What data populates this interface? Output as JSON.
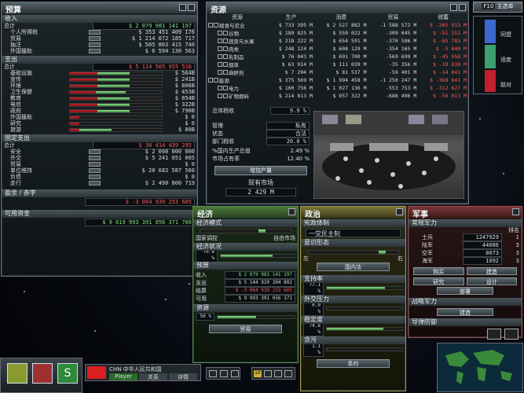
{
  "budget": {
    "title": "预算",
    "income": {
      "header": "收入",
      "total_label": "总计",
      "total": "$ 2 079 981 141 197",
      "items": [
        {
          "label": "个人所得税",
          "value": "$ 353 451 409 176"
        },
        {
          "label": "贸易",
          "value": "$ 1 214 072 185 717"
        },
        {
          "label": "抽注",
          "value": "$ 505 863 415 740"
        },
        {
          "label": "外国援助",
          "value": "$ 6 594 130 563"
        }
      ]
    },
    "expense": {
      "header": "支出",
      "total_label": "总计",
      "total": "$ 5 114 505 955 516",
      "items": [
        {
          "label": "基础设施",
          "value": "$ 564B",
          "fill": 0.3,
          "g": 0.35
        },
        {
          "label": "宣传",
          "value": "$ 241B",
          "fill": 0.3,
          "g": 0.35
        },
        {
          "label": "环境",
          "value": "$ 806B",
          "fill": 0.3,
          "g": 0.35
        },
        {
          "label": "卫生保健",
          "value": "$ 453B",
          "fill": 0.28,
          "g": 0.33
        },
        {
          "label": "教育",
          "value": "$ 854B",
          "fill": 0.3,
          "g": 0.35
        },
        {
          "label": "电信",
          "value": "$ 322B",
          "fill": 0.3,
          "g": 0.35
        },
        {
          "label": "政府",
          "value": "$ 790B",
          "fill": 0.3,
          "g": 0.35
        },
        {
          "label": "外国援助",
          "value": "$ 0",
          "fill": 0.1,
          "g": 0.0
        },
        {
          "label": "研究",
          "value": "$ 0",
          "fill": 0.1,
          "g": 0.0
        },
        {
          "label": "旅游",
          "value": "$ 80B",
          "fill": 0.1,
          "g": 0.35
        }
      ]
    },
    "fixed": {
      "header": "固定支出",
      "total_label": "总计",
      "total": "$ 30 414 439 285",
      "items": [
        {
          "label": "安全",
          "value": "$ 2 000 000 000"
        },
        {
          "label": "外交",
          "value": "$ 5 241 051 005"
        },
        {
          "label": "贸易",
          "value": "$ 0"
        },
        {
          "label": "单位维持",
          "value": "$ 20 682 587 560"
        },
        {
          "label": "负债",
          "value": "$ 0"
        },
        {
          "label": "走行",
          "value": "$ 2 490 800 719"
        }
      ]
    },
    "surplus": {
      "header": "盈余 / 赤字",
      "value": "$ -3 064 939 253 605"
    },
    "available": {
      "header": "可用资金",
      "value": "$ 9 619 993 391 056 371 700"
    }
  },
  "resources": {
    "title": "资源",
    "columns": [
      "资源",
      "生产",
      "消费",
      "贸易",
      "储蓄"
    ],
    "rows": [
      {
        "name": "粮食与农业",
        "prod": "$ 733 395 M",
        "cons": "$ 2 527 882 M",
        "trade": "-1 588 572 M",
        "bal": "$ -205 913 M",
        "lvl": 0
      },
      {
        "name": "谷物",
        "prod": "$ 189 825 M",
        "cons": "$ 550 022 M",
        "trade": "-309 045 M",
        "bal": "$ -51 151 M",
        "lvl": 1
      },
      {
        "name": "蔬菜与水果",
        "prod": "$ 218 222 M",
        "cons": "$ 654 591 M",
        "trade": "-370 586 M",
        "bal": "$ -65 783 M",
        "lvl": 1
      },
      {
        "name": "肉类",
        "prod": "$ 248 124 M",
        "cons": "$ 608 129 M",
        "trade": "-354 165 M",
        "bal": "$ -5 840 M",
        "lvl": 1
      },
      {
        "name": "乳制品",
        "prod": "$ 76 043 M",
        "cons": "$ 691 700 M",
        "trade": "-569 699 M",
        "bal": "$ -45 958 M",
        "lvl": 1
      },
      {
        "name": "烟草",
        "prod": "$ 63 914 M",
        "cons": "$ 111 039 M",
        "trade": "-35 356 M",
        "bal": "$ -19 838 M",
        "lvl": 1
      },
      {
        "name": "麻醉剂",
        "prod": "$ 7 294 M",
        "cons": "$ 81 537 M",
        "trade": "-59 401 M",
        "bal": "$ -14 841 M",
        "lvl": 1
      },
      {
        "name": "能源",
        "prod": "$ 375 569 M",
        "cons": "$ 1 994 458 M",
        "trade": "-1 250 247 M",
        "bal": "$ -368 641 M",
        "lvl": 0
      },
      {
        "name": "电力",
        "prod": "$ 160 756 M",
        "cons": "$ 1 027 136 M",
        "trade": "-553 753 M",
        "bal": "$ -312 627 M",
        "lvl": 1
      },
      {
        "name": "矿物燃料",
        "prod": "$ 214 813 M",
        "cons": "$ 957 322 M",
        "trade": "-686 496 M",
        "bal": "$ -56 013 M",
        "lvl": 1
      }
    ],
    "tax_label": "总体税收",
    "tax_value": "9.9 %",
    "mgmt_label": "管理",
    "mgmt_value": "私有",
    "state_label": "状态",
    "state_value": "合法",
    "dept_tax_label": "部门税收",
    "dept_tax_value": "20.0 %",
    "gdp_label": "%国内生产总值",
    "gdp_value": "2.49 %",
    "share_label": "市场占有率",
    "share_value": "12.40 %",
    "increase_btn": "增加产量",
    "market_label": "现有市场",
    "market_value": "2 429 M"
  },
  "economy": {
    "title": "经济",
    "mode_header": "经济模式",
    "mode_left": "国家调控",
    "mode_right": "自由市场",
    "mode_level": 0.68,
    "status_header": "经济状况",
    "status_value": "70.8 %",
    "status_level": 0.7,
    "budget_header": "预算",
    "income_label": "收入",
    "income_value": "$ 2 079 981 141 197",
    "expense_label": "支出",
    "expense_value": "$ 5 144 920 394 802",
    "balance_label": "结算",
    "balance_value": "$ -3 064 939 253 605",
    "available_label": "可用",
    "available_value": "$ 9 993 391 056 371",
    "resources_header": "资源",
    "resources_value": "50 %",
    "resources_level": 0.5,
    "trade_btn": "贸易"
  },
  "politics": {
    "title": "政治",
    "constitution_header": "宪政体制",
    "constitution_value": "一党民主制",
    "ideology_header": "意识形态",
    "left": "左",
    "right": "右",
    "ideology_level": 0.82,
    "domestic_btn": "国内法",
    "approval_header": "支持率",
    "approval_value": "77.1 %",
    "approval_level": 0.77,
    "pressure_header": "外交压力",
    "pressure_value": "0.0 %",
    "pressure_level": 0.0,
    "stability_header": "稳定度",
    "stability_value": "74.8 %",
    "stability_level": 0.75,
    "corruption_header": "贪污",
    "corruption_value": "1.1 %",
    "corruption_level": 0.01,
    "treaty_btn": "条约"
  },
  "military": {
    "title": "军事",
    "conv_header": "常规军力",
    "rank_label": "排名",
    "units": [
      {
        "label": "士兵",
        "count": "1247929",
        "rank": "1"
      },
      {
        "label": "陆军",
        "count": "44086",
        "rank": "3"
      },
      {
        "label": "空军",
        "count": "8073",
        "rank": "3"
      },
      {
        "label": "海军",
        "count": "1092",
        "rank": "3"
      }
    ],
    "buy_btn": "购买",
    "build_btn": "建造",
    "research_btn": "研究",
    "design_btn": "设计",
    "deploy_btn": "部署",
    "strategic_header": "战略军力",
    "build2_btn": "建造",
    "missile_header": "导弹防御"
  },
  "topright": {
    "key": "F10",
    "label": "主选单",
    "legend": [
      "同盟",
      "适度",
      "敌对"
    ]
  },
  "bottom": {
    "country": "CHN 中华人民共和国",
    "player": "Player",
    "relation": "关系",
    "detail": "详情",
    "speed": "10"
  },
  "colors": {
    "accent": "#6ab04c",
    "red": "#ff5a5a",
    "ally": "#3a6ad0",
    "neutral": "#3aa070",
    "hostile": "#c02030"
  }
}
